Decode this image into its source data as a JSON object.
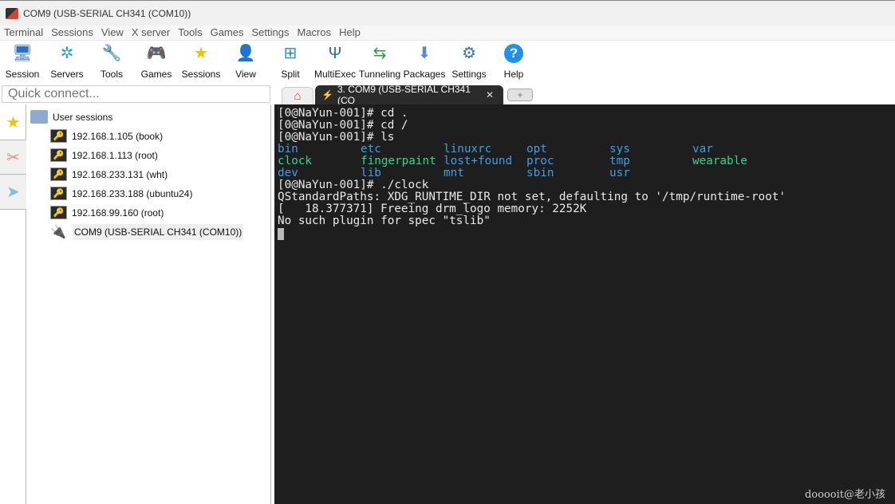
{
  "window": {
    "title": "COM9  (USB-SERIAL CH341 (COM10))"
  },
  "menu": [
    "Terminal",
    "Sessions",
    "View",
    "X server",
    "Tools",
    "Games",
    "Settings",
    "Macros",
    "Help"
  ],
  "toolbar": [
    {
      "label": "Session",
      "icon": "session-monitor-icon",
      "glyph": "🖥"
    },
    {
      "label": "Servers",
      "icon": "servers-icon",
      "glyph": "✲"
    },
    {
      "label": "Tools",
      "icon": "tools-knife-icon",
      "glyph": "🔧"
    },
    {
      "label": "Games",
      "icon": "gamepad-icon",
      "glyph": "🎮"
    },
    {
      "label": "Sessions",
      "icon": "star-icon",
      "glyph": "★"
    },
    {
      "label": "View",
      "icon": "view-icon",
      "glyph": "👤"
    },
    {
      "label": "Split",
      "icon": "split-icon",
      "glyph": "⊞"
    },
    {
      "label": "MultiExec",
      "icon": "multiexec-icon",
      "glyph": "Ψ"
    },
    {
      "label": "Tunneling",
      "icon": "tunneling-icon",
      "glyph": "⇆"
    },
    {
      "label": "Packages",
      "icon": "packages-icon",
      "glyph": "⬇"
    },
    {
      "label": "Settings",
      "icon": "gears-icon",
      "glyph": "⚙"
    },
    {
      "label": "Help",
      "icon": "help-icon",
      "glyph": "?"
    }
  ],
  "quick_connect": {
    "placeholder": "Quick connect..."
  },
  "tabs": {
    "active_label": "3. COM9  (USB-SERIAL CH341 (CO",
    "close": "✕",
    "plus": "+",
    "home": "⌂"
  },
  "sessions": {
    "root": "User sessions",
    "items": [
      "192.168.1.105 (book)",
      "192.168.1.113 (root)",
      "192.168.233.131 (wht)",
      "192.168.233.188 (ubuntu24)",
      "192.168.99.160 (root)"
    ],
    "serial": "COM9  (USB-SERIAL CH341 (COM10))"
  },
  "terminal": {
    "before": [
      "[0@NaYun-001]# cd .",
      "[0@NaYun-001]# cd /",
      "[0@NaYun-001]# ls"
    ],
    "ls": [
      [
        {
          "t": "bin",
          "c": "b"
        },
        {
          "t": "etc",
          "c": "b"
        },
        {
          "t": "linuxrc",
          "c": "b"
        },
        {
          "t": "opt",
          "c": "b"
        },
        {
          "t": "sys",
          "c": "b"
        },
        {
          "t": "var",
          "c": "b"
        }
      ],
      [
        {
          "t": "clock",
          "c": "gr"
        },
        {
          "t": "fingerpaint",
          "c": "gr"
        },
        {
          "t": "lost+found",
          "c": "b"
        },
        {
          "t": "proc",
          "c": "b"
        },
        {
          "t": "tmp",
          "c": "b"
        },
        {
          "t": "wearable",
          "c": "gr"
        }
      ],
      [
        {
          "t": "dev",
          "c": "b"
        },
        {
          "t": "lib",
          "c": "b"
        },
        {
          "t": "mnt",
          "c": "b"
        },
        {
          "t": "sbin",
          "c": "b"
        },
        {
          "t": "usr",
          "c": "b"
        }
      ]
    ],
    "after": [
      "[0@NaYun-001]# ./clock",
      "QStandardPaths: XDG_RUNTIME_DIR not set, defaulting to '/tmp/runtime-root'",
      "[   18.377371] Freeing drm_logo memory: 2252K",
      "No such plugin for spec \"tslib\""
    ],
    "colors": {
      "background": "#1e1e1e",
      "dir": "#3aa0e6",
      "exec": "#2bd88c"
    }
  },
  "watermark": "dooooit@老小孩"
}
